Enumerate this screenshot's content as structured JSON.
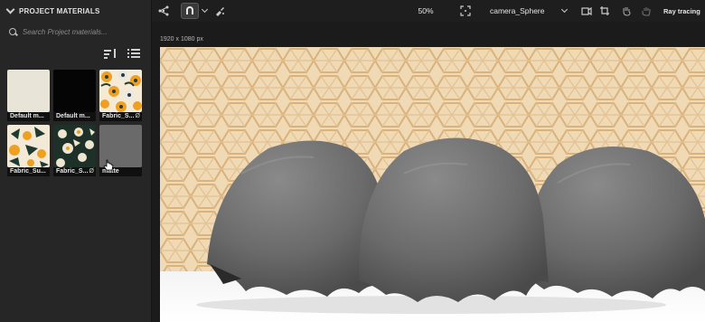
{
  "panel": {
    "title": "PROJECT MATERIALS",
    "search_placeholder": "Search Project materials..."
  },
  "materials": [
    {
      "label": "Default m...",
      "linked": false
    },
    {
      "label": "Default m...",
      "linked": false
    },
    {
      "label": "Fabric_S...",
      "linked": true
    },
    {
      "label": "Fabric_Su...",
      "linked": false
    },
    {
      "label": "Fabric_S...",
      "linked": true
    },
    {
      "label": "matte",
      "linked": false
    }
  ],
  "link_glyph": "Ø",
  "toolbar": {
    "zoom": "50%",
    "camera": "camera_Sphere",
    "render_mode": "Ray tracing"
  },
  "viewport": {
    "resolution": "1920 x 1080 px"
  },
  "colors": {
    "accent_orange": "#f0a020",
    "pattern_cream": "#efe4cf",
    "cloth_gray": "#6e6e6e"
  }
}
